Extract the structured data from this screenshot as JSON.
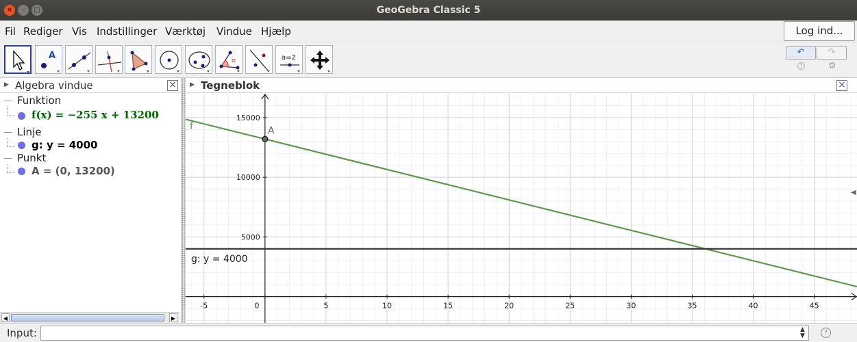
{
  "window": {
    "title": "GeoGebra Classic 5"
  },
  "menu": {
    "items": [
      "Fil",
      "Rediger",
      "Vis",
      "Indstillinger",
      "Værktøj",
      "Vindue",
      "Hjælp"
    ],
    "login_label": "Log ind..."
  },
  "toolbar": {
    "tools": [
      {
        "name": "move-tool-icon",
        "active": true
      },
      {
        "name": "point-tool-icon"
      },
      {
        "name": "line-tool-icon"
      },
      {
        "name": "perpendicular-line-tool-icon"
      },
      {
        "name": "polygon-tool-icon"
      },
      {
        "name": "circle-tool-icon"
      },
      {
        "name": "conic-tool-icon"
      },
      {
        "name": "angle-tool-icon"
      },
      {
        "name": "reflect-tool-icon"
      },
      {
        "name": "slider-tool-icon",
        "label": "a=2"
      },
      {
        "name": "move-graphics-tool-icon"
      }
    ],
    "undo_glyph": "↶",
    "redo_glyph": "↷",
    "help_glyph": "?",
    "settings_glyph": "⚙"
  },
  "algebra": {
    "title": "Algebra vindue",
    "groups": [
      {
        "label": "Funktion",
        "item": "f(x) = −255 x + 13200",
        "color": "#006400"
      },
      {
        "label": "Linje",
        "item": "g: y = 4000",
        "color": "#000000"
      },
      {
        "label": "Punkt",
        "item": "A = (0, 13200)",
        "color": "#555555"
      }
    ]
  },
  "graphics": {
    "title": "Tegneblok",
    "function_label": "f",
    "point_label": "A",
    "line_label": "g: y = 4000",
    "function_color": "#5c9a4e",
    "line_color": "#333333"
  },
  "chart_data": {
    "type": "line",
    "xlim": [
      -6.5,
      48.5
    ],
    "ylim": [
      -2200,
      17000
    ],
    "x_ticks": [
      -5,
      0,
      5,
      10,
      15,
      20,
      25,
      30,
      35,
      40,
      45
    ],
    "y_ticks": [
      5000,
      10000,
      15000
    ],
    "grid": true,
    "series": [
      {
        "name": "f",
        "slope": -255,
        "intercept": 13200
      },
      {
        "name": "g",
        "slope": 0,
        "intercept": 4000
      }
    ],
    "points": [
      {
        "name": "A",
        "x": 0,
        "y": 13200
      }
    ]
  },
  "input": {
    "label": "Input:",
    "value": "",
    "placeholder": ""
  }
}
